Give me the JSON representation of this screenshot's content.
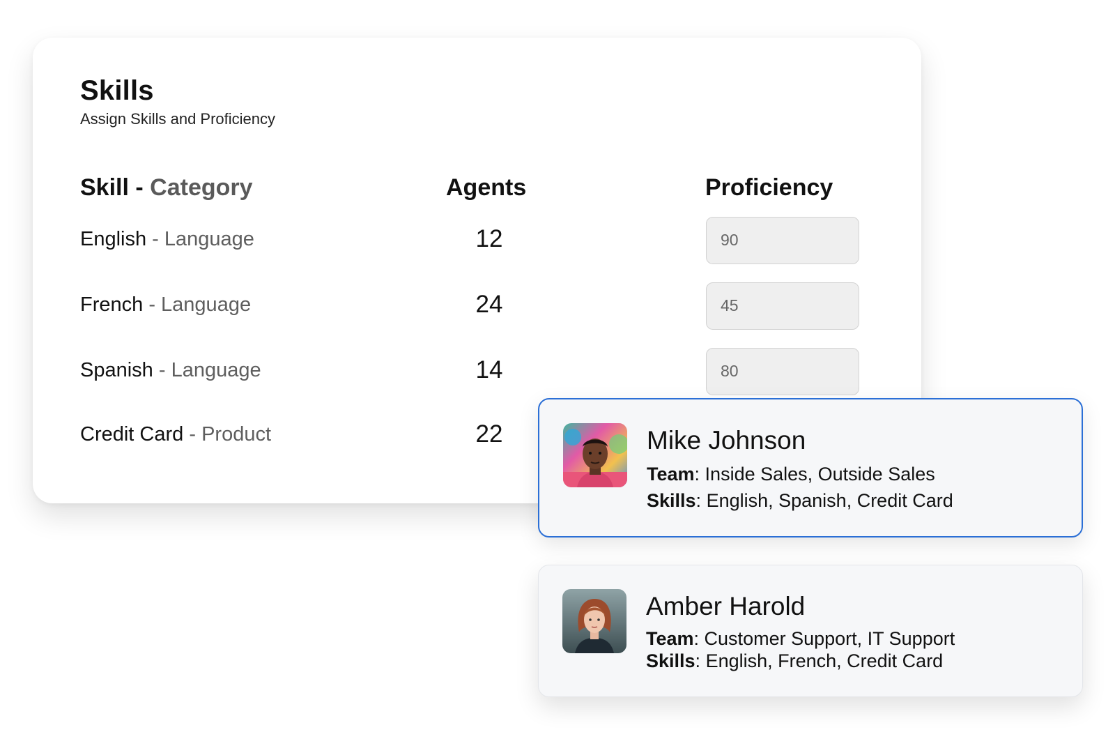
{
  "skills_panel": {
    "title": "Skills",
    "subtitle": "Assign Skills and Proficiency",
    "columns": {
      "skill": "Skill",
      "separator": " - ",
      "category": "Category",
      "agents": "Agents",
      "proficiency": "Proficiency"
    },
    "rows": [
      {
        "skill": "English",
        "category": "Language",
        "agents": "12",
        "proficiency": "90"
      },
      {
        "skill": "French",
        "category": "Language",
        "agents": "24",
        "proficiency": "45"
      },
      {
        "skill": "Spanish",
        "category": "Language",
        "agents": "14",
        "proficiency": "80"
      },
      {
        "skill": "Credit Card",
        "category": "Product",
        "agents": "22",
        "proficiency": ""
      }
    ]
  },
  "agents": [
    {
      "name": "Mike Johnson",
      "team_label": "Team",
      "team": "Inside Sales, Outside Sales",
      "skills_label": "Skills",
      "skills": "English, Spanish, Credit Card",
      "selected": true
    },
    {
      "name": "Amber Harold",
      "team_label": "Team",
      "team": "Customer Support, IT Support",
      "skills_label": "Skills",
      "skills": "English, French, Credit Card",
      "selected": false
    }
  ],
  "colors": {
    "selection_border": "#2b6fd6",
    "card_background": "#f6f7f9",
    "input_background": "#efefef"
  }
}
